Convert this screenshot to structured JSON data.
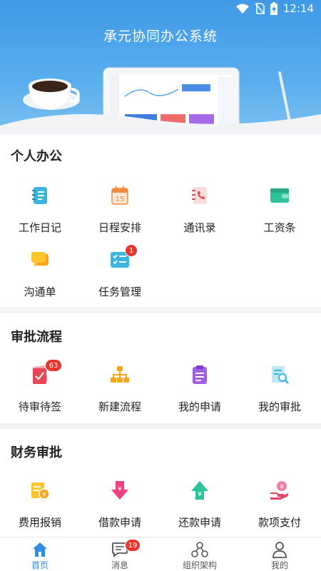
{
  "status_bar": {
    "time": "12:14"
  },
  "app": {
    "title": "承元协同办公系统"
  },
  "sections": {
    "personal": {
      "title": "个人办公",
      "items": [
        {
          "label": "工作日记",
          "icon": "notebook-icon"
        },
        {
          "label": "日程安排",
          "icon": "calendar-icon",
          "icon_text": "15"
        },
        {
          "label": "通讯录",
          "icon": "contacts-icon"
        },
        {
          "label": "工资条",
          "icon": "wallet-icon"
        },
        {
          "label": "沟通单",
          "icon": "chat-icon"
        },
        {
          "label": "任务管理",
          "icon": "task-list-icon",
          "badge": "1"
        }
      ]
    },
    "approval": {
      "title": "审批流程",
      "items": [
        {
          "label": "待审待签",
          "icon": "pending-doc-icon",
          "badge": "63"
        },
        {
          "label": "新建流程",
          "icon": "flowchart-icon"
        },
        {
          "label": "我的申请",
          "icon": "clipboard-icon"
        },
        {
          "label": "我的审批",
          "icon": "doc-search-icon"
        }
      ]
    },
    "finance": {
      "title": "财务审批",
      "items": [
        {
          "label": "费用报销",
          "icon": "reimburse-icon"
        },
        {
          "label": "借款申请",
          "icon": "borrow-icon"
        },
        {
          "label": "还款申请",
          "icon": "repay-icon"
        },
        {
          "label": "款项支付",
          "icon": "payment-icon"
        }
      ]
    }
  },
  "bottom_nav": [
    {
      "label": "首页",
      "icon": "home-icon",
      "active": true
    },
    {
      "label": "消息",
      "icon": "message-icon",
      "badge": "19"
    },
    {
      "label": "组织架构",
      "icon": "org-icon"
    },
    {
      "label": "我的",
      "icon": "profile-icon"
    }
  ],
  "colors": {
    "header_blue": "#3f99e6",
    "accent": "#2e8de0",
    "badge_red": "#e8342c"
  }
}
